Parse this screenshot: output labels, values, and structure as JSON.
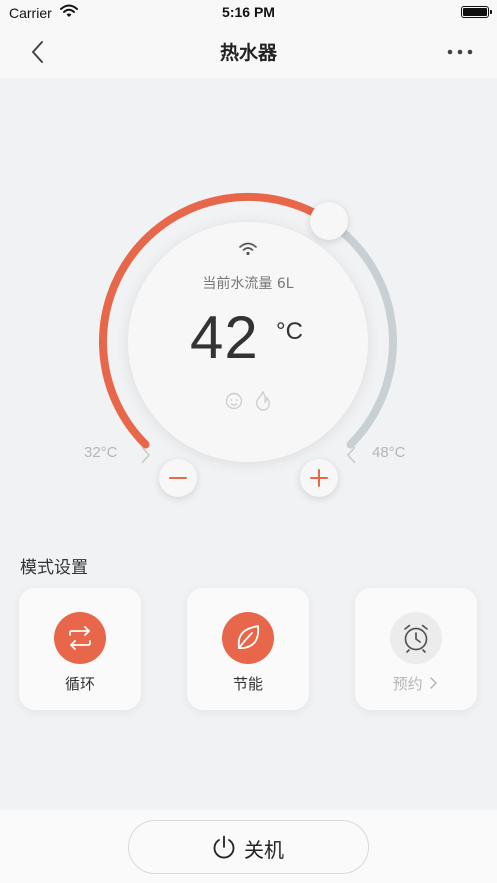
{
  "status_bar": {
    "carrier": "Carrier",
    "time": "5:16 PM"
  },
  "nav": {
    "title": "热水器"
  },
  "dial": {
    "flow_text": "当前水流量 6L",
    "temperature": "42",
    "unit": "°C",
    "min_label": "32°C",
    "max_label": "48°C",
    "min_value": 32,
    "max_value": 48,
    "current_value": 42
  },
  "modes": {
    "title": "模式设置",
    "items": [
      {
        "label": "循环",
        "icon": "cycle-icon",
        "active": true
      },
      {
        "label": "节能",
        "icon": "leaf-icon",
        "active": true
      },
      {
        "label": "预约",
        "icon": "alarm-clock-icon",
        "active": false
      }
    ]
  },
  "power": {
    "label": "关机"
  },
  "colors": {
    "accent": "#e8664a",
    "track_inactive": "#c9d0d4",
    "background": "#f1f2f4",
    "muted_text": "#b6b6b6"
  }
}
